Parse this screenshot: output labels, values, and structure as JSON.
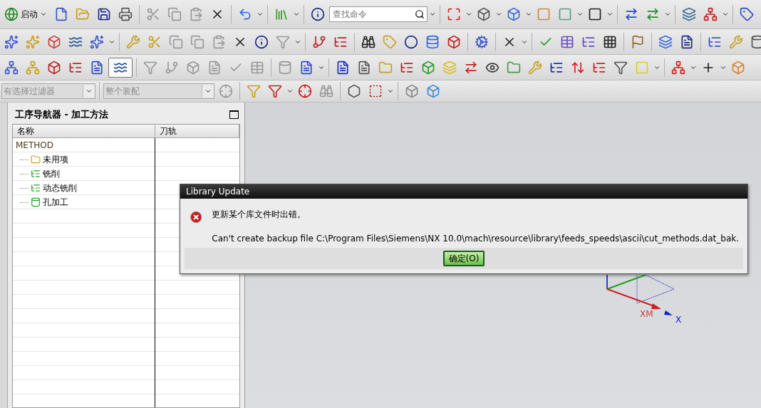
{
  "toolbar": {
    "start_label": "启动",
    "search": {
      "placeholder": "查找命令"
    }
  },
  "selection_bar": {
    "filter": "有选择过滤器",
    "scope": "整个装配"
  },
  "navigator": {
    "title": "工序导航器 - 加工方法",
    "columns": [
      "名称",
      "刀轨"
    ],
    "root": {
      "name": "METHOD",
      "children": [
        {
          "name": "未用项",
          "kind": "unused"
        },
        {
          "name": "铣削",
          "kind": "mill"
        },
        {
          "name": "动态铣削",
          "kind": "mill"
        },
        {
          "name": "孔加工",
          "kind": "drill"
        }
      ]
    }
  },
  "dialog": {
    "title": "Library Update",
    "message": "更新某个库文件时出错。",
    "detail": "Can't create backup file C:\\Program Files\\Siemens\\NX 10.0\\mach\\resource\\library\\feeds_speeds\\ascii\\cut_methods.dat_bak.",
    "button": "确定(O)"
  },
  "viewport": {
    "axis_labels": [
      "XM",
      "X"
    ]
  }
}
